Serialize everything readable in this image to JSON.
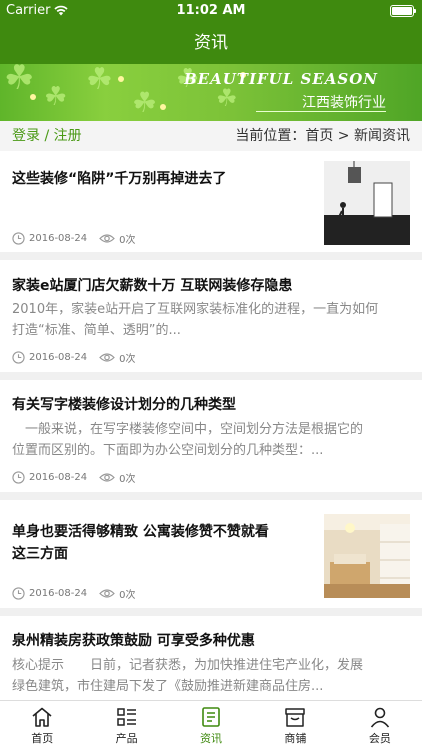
{
  "status": {
    "carrier": "Carrier",
    "time": "11:02 AM"
  },
  "nav": {
    "title": "资讯"
  },
  "banner": {
    "season": "BEAUTIFUL SEASON",
    "subtitle": "江西装饰行业"
  },
  "breadcrumb": {
    "login": "登录",
    "sep": "/",
    "register": "注册",
    "location": "当前位置：首页 > 新闻资讯"
  },
  "articles": [
    {
      "title": "这些装修“陷阱”千万别再掉进去了",
      "desc1": "",
      "desc2": "",
      "date": "2016-08-24",
      "views": "0次"
    },
    {
      "title": "家装e站厦门店欠薪数十万 互联网装修存隐患",
      "desc1": "2010年，家装e站开启了互联网家装标准化的进程，一直为如何",
      "desc2": "打造“标准、简单、透明”的...",
      "date": "2016-08-24",
      "views": "0次"
    },
    {
      "title": "有关写字楼装修设计划分的几种类型",
      "desc1": "　一般来说，在写字楼装修空间中，空间划分方法是根据它的",
      "desc2": "位置而区别的。下面即为办公空间划分的几种类型：...",
      "date": "2016-08-24",
      "views": "0次"
    },
    {
      "title": "单身也要活得够精致 公寓装修赞不赞就看",
      "title2": "这三方面",
      "date": "2016-08-24",
      "views": "0次"
    },
    {
      "title": "泉州精装房获政策鼓励 可享受多种优惠",
      "desc1": "核心提示　　日前，记者获悉，为加快推进住宅产业化，发展",
      "desc2": "绿色建筑，市住建局下发了《鼓励推进新建商品住房..."
    }
  ],
  "tabs": [
    {
      "label": "首页",
      "icon": "home-icon"
    },
    {
      "label": "产品",
      "icon": "grid-list-icon"
    },
    {
      "label": "资讯",
      "icon": "news-icon"
    },
    {
      "label": "商铺",
      "icon": "shop-icon"
    },
    {
      "label": "会员",
      "icon": "user-icon"
    }
  ],
  "colors": {
    "brand": "#3f8a0f",
    "link": "#4a9a16"
  }
}
